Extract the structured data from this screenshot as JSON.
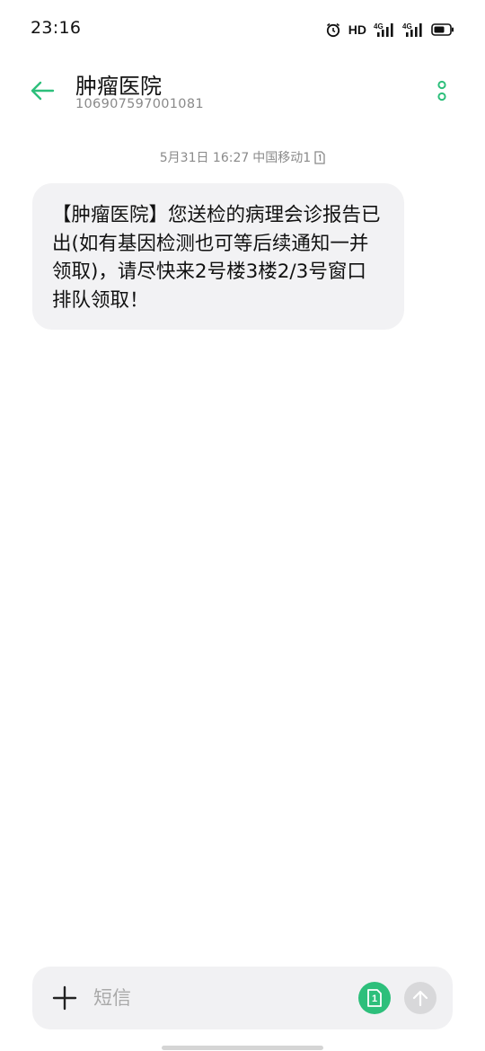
{
  "status_bar": {
    "time": "23:16",
    "hd_label": "HD",
    "icons": [
      "alarm-icon",
      "hd-icon",
      "signal-4g-icon",
      "signal-4g-icon",
      "battery-icon"
    ]
  },
  "header": {
    "title": "肿瘤医院",
    "subtitle": "106907597001081",
    "back_icon": "back-arrow-icon",
    "more_icon": "more-vertical-icon",
    "accent_color": "#2dbf7b"
  },
  "message": {
    "date_time": "5月31日 16:27",
    "carrier": "中国移动1",
    "body": "【肿瘤医院】您送检的病理会诊报告已出(如有基因检测也可等后续通知一并领取)，请尽快来2号楼3楼2/3号窗口排队领取！"
  },
  "composer": {
    "placeholder": "短信",
    "sim_label": "1",
    "plus_icon": "plus-icon",
    "send_icon": "send-arrow-icon"
  }
}
